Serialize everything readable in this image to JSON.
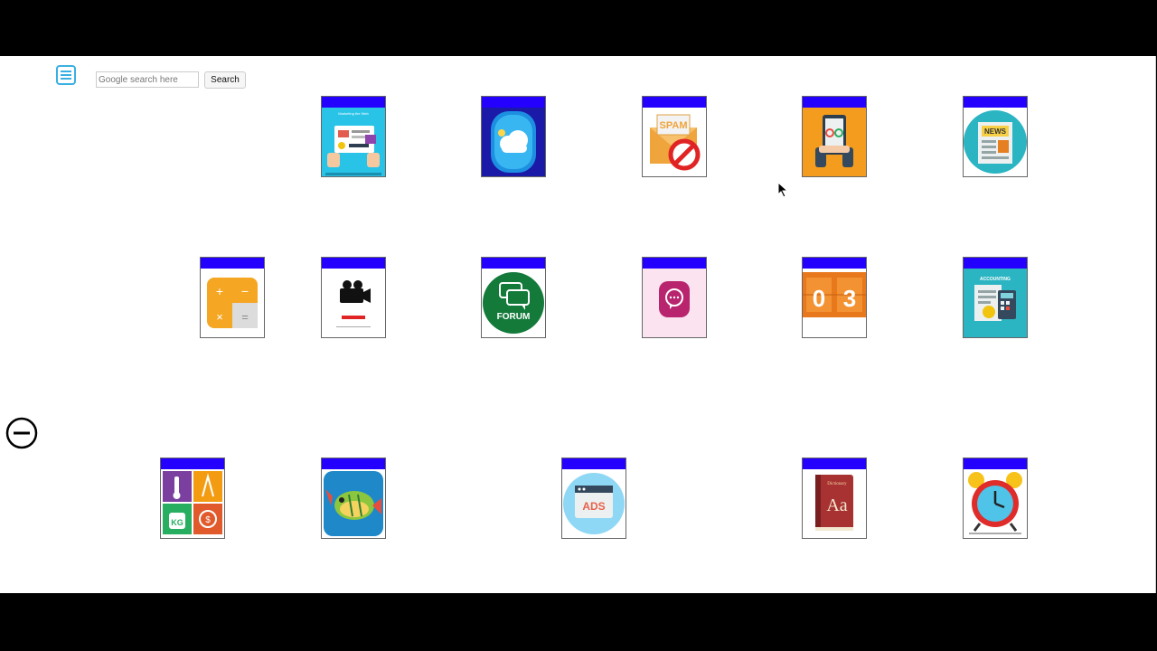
{
  "header": {
    "menu_icon": "hamburger-menu-icon",
    "search_placeholder": "Google search here",
    "search_value": "",
    "search_button_label": "Search"
  },
  "colors": {
    "tile_bar": "#2400ff",
    "menu_icon": "#3ab0e2"
  },
  "tiles_row1": [
    {
      "app": "marketing-app",
      "icon": "marketing-screen-icon",
      "caption": "Marketing the Web"
    },
    {
      "app": "cloud-weather-app",
      "icon": "cloud-weather-icon"
    },
    {
      "app": "spam-blocker-app",
      "icon": "spam-block-icon",
      "label": "SPAM"
    },
    {
      "app": "mobile-app",
      "icon": "phone-hands-icon"
    },
    {
      "app": "news-app",
      "icon": "newspaper-icon",
      "label": "NEWS"
    }
  ],
  "tiles_row2": [
    {
      "app": "calculator-app",
      "icon": "calculator-icon"
    },
    {
      "app": "video-recorder-app",
      "icon": "video-camera-icon"
    },
    {
      "app": "forum-app",
      "icon": "forum-chat-icon",
      "label": "FORUM"
    },
    {
      "app": "messenger-app",
      "icon": "chat-bubble-icon"
    },
    {
      "app": "scoreboard-app",
      "icon": "scoreboard-icon",
      "digits": [
        "0",
        "3"
      ]
    },
    {
      "app": "accounting-app",
      "icon": "accounting-icon",
      "label": "ACCOUNTING"
    }
  ],
  "tiles_row3": [
    {
      "app": "unit-converter-app",
      "icon": "unit-converter-icon",
      "label": "KG"
    },
    {
      "app": "fishing-game-app",
      "icon": "fish-icon"
    },
    {
      "app": "ads-app",
      "icon": "ads-icon",
      "label": "ADS"
    },
    {
      "app": "dictionary-app",
      "icon": "dictionary-book-icon",
      "label": "Aa",
      "sublabel": "Dictionary"
    },
    {
      "app": "alarm-clock-app",
      "icon": "alarm-clock-icon"
    }
  ],
  "controls": {
    "zoom_out_icon": "minus-circle-icon"
  }
}
